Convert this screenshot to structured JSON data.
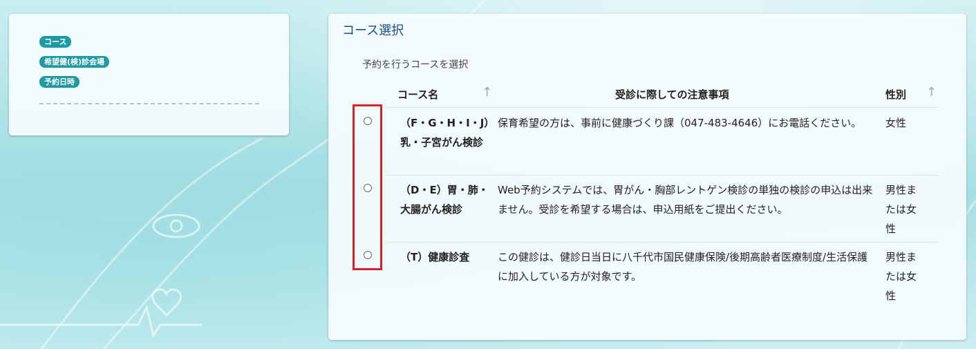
{
  "sidebar": {
    "steps": [
      "コース",
      "希望健(検)診会場",
      "予約日時"
    ]
  },
  "main": {
    "title": "コース選択",
    "subtitle": "予約を行うコースを選択",
    "columns": {
      "course": "コース名",
      "notes": "受診に際しての注意事項",
      "gender": "性別"
    },
    "sort_arrow": "↑",
    "rows": [
      {
        "course": "（F・G・H・I・J）乳・子宮がん検診",
        "notes": "保育希望の方は、事前に健康づくり課（047-483-4646）にお電話ください。",
        "gender": "女性"
      },
      {
        "course": "（D・E）胃・肺・大腸がん検診",
        "notes": "Web予約システムでは、胃がん・胸部レントゲン検診の単独の検診の申込は出来ません。受診を希望する場合は、申込用紙をご提出ください。",
        "gender": "男性または女性"
      },
      {
        "course": "（T）健康診査",
        "notes": "この健診は、健診日当日に八千代市国民健康保険/後期高齢者医療制度/生活保護に加入している方が対象です。",
        "gender": "男性または女性"
      }
    ]
  },
  "colors": {
    "badge": "#1e9aa4",
    "title": "#1b4e86",
    "highlight": "#d6202a"
  }
}
